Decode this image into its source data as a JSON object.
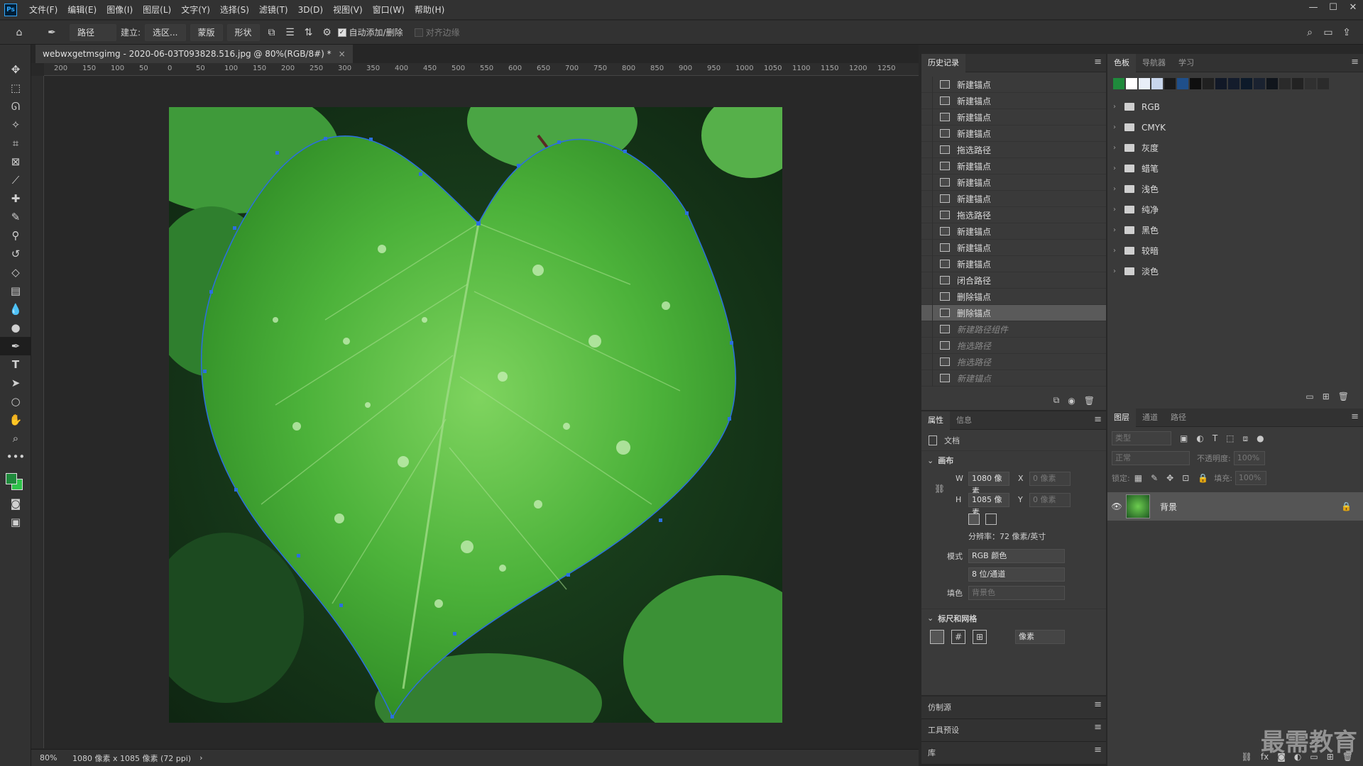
{
  "menubar": {
    "logo": "Ps",
    "items": [
      "文件(F)",
      "编辑(E)",
      "图像(I)",
      "图层(L)",
      "文字(Y)",
      "选择(S)",
      "滤镜(T)",
      "3D(D)",
      "视图(V)",
      "窗口(W)",
      "帮助(H)"
    ],
    "window_controls": [
      "—",
      "☐",
      "✕"
    ]
  },
  "options": {
    "mode": "路径",
    "build_label": "建立:",
    "selection_btn": "选区...",
    "mask_btn": "蒙版",
    "shape_btn": "形状",
    "auto_add_label": "自动添加/删除",
    "align_edges_label": "对齐边缘"
  },
  "document": {
    "tab_title": "webwxgetmsgimg - 2020-06-03T093828.516.jpg @ 80%(RGB/8#) *",
    "ruler_ticks": [
      "200",
      "150",
      "100",
      "50",
      "0",
      "50",
      "100",
      "150",
      "200",
      "250",
      "300",
      "350",
      "400",
      "450",
      "500",
      "550",
      "600",
      "650",
      "700",
      "750",
      "800",
      "850",
      "900",
      "950",
      "1000",
      "1050",
      "1100",
      "1150",
      "1200",
      "1250"
    ]
  },
  "status": {
    "zoom": "80%",
    "info": "1080 像素 x 1085 像素 (72 ppi)"
  },
  "history": {
    "tab": "历史记录",
    "items": [
      {
        "label": "新建锚点",
        "state": "normal"
      },
      {
        "label": "新建锚点",
        "state": "normal"
      },
      {
        "label": "新建锚点",
        "state": "normal"
      },
      {
        "label": "新建锚点",
        "state": "normal"
      },
      {
        "label": "拖选路径",
        "state": "normal"
      },
      {
        "label": "新建锚点",
        "state": "normal"
      },
      {
        "label": "新建锚点",
        "state": "normal"
      },
      {
        "label": "新建锚点",
        "state": "normal"
      },
      {
        "label": "拖选路径",
        "state": "normal"
      },
      {
        "label": "新建锚点",
        "state": "normal"
      },
      {
        "label": "新建锚点",
        "state": "normal"
      },
      {
        "label": "新建锚点",
        "state": "normal"
      },
      {
        "label": "闭合路径",
        "state": "normal"
      },
      {
        "label": "删除锚点",
        "state": "normal"
      },
      {
        "label": "删除锚点",
        "state": "selected"
      },
      {
        "label": "新建路径组件",
        "state": "dim"
      },
      {
        "label": "拖选路径",
        "state": "dim"
      },
      {
        "label": "拖选路径",
        "state": "dim"
      },
      {
        "label": "新建锚点",
        "state": "dim"
      }
    ]
  },
  "properties": {
    "tabs": [
      "属性",
      "信息"
    ],
    "doc_label": "文档",
    "canvas_section": "画布",
    "w_label": "W",
    "w_value": "1080 像素",
    "h_label": "H",
    "h_value": "1085 像素",
    "x_label": "X",
    "x_placeholder": "0 像素",
    "y_label": "Y",
    "y_placeholder": "0 像素",
    "resolution": "分辨率：72 像素/英寸",
    "mode_label": "模式",
    "mode_value": "RGB 颜色",
    "depth_value": "8 位/通道",
    "fill_label": "填色",
    "fill_value": "背景色",
    "ruler_section": "标尺和网格",
    "unit_value": "像素"
  },
  "collapsed_panels": [
    "仿制源",
    "工具预设",
    "库"
  ],
  "swatches": {
    "tabs": [
      "色板",
      "导航器",
      "学习"
    ],
    "colors": [
      "#1f8a3c",
      "#ffffff",
      "#e8eef8",
      "#c8d6ec",
      "#1a1a1a",
      "#1f4f8a",
      "#0f0f0f",
      "#202020",
      "#111827",
      "#141c2c",
      "#0d1a2a",
      "#1a2230",
      "#10151c",
      "#2a2a2a",
      "#222222",
      "#303030",
      "#2b2b2b"
    ],
    "groups": [
      "RGB",
      "CMYK",
      "灰度",
      "蜡笔",
      "浅色",
      "纯净",
      "黑色",
      "较暗",
      "淡色"
    ]
  },
  "layers": {
    "tabs": [
      "图层",
      "通道",
      "路径"
    ],
    "search_placeholder": "类型",
    "blend_mode": "正常",
    "opacity_label": "不透明度:",
    "opacity_value": "100%",
    "lock_label": "锁定:",
    "fill_label": "填充:",
    "fill_value": "100%",
    "layer_name": "背景"
  },
  "watermark": "最需教育",
  "colors": {
    "foreground": "#1f8a3c",
    "background": "#2ec24a",
    "path_anchor": "#2b6fe0"
  }
}
